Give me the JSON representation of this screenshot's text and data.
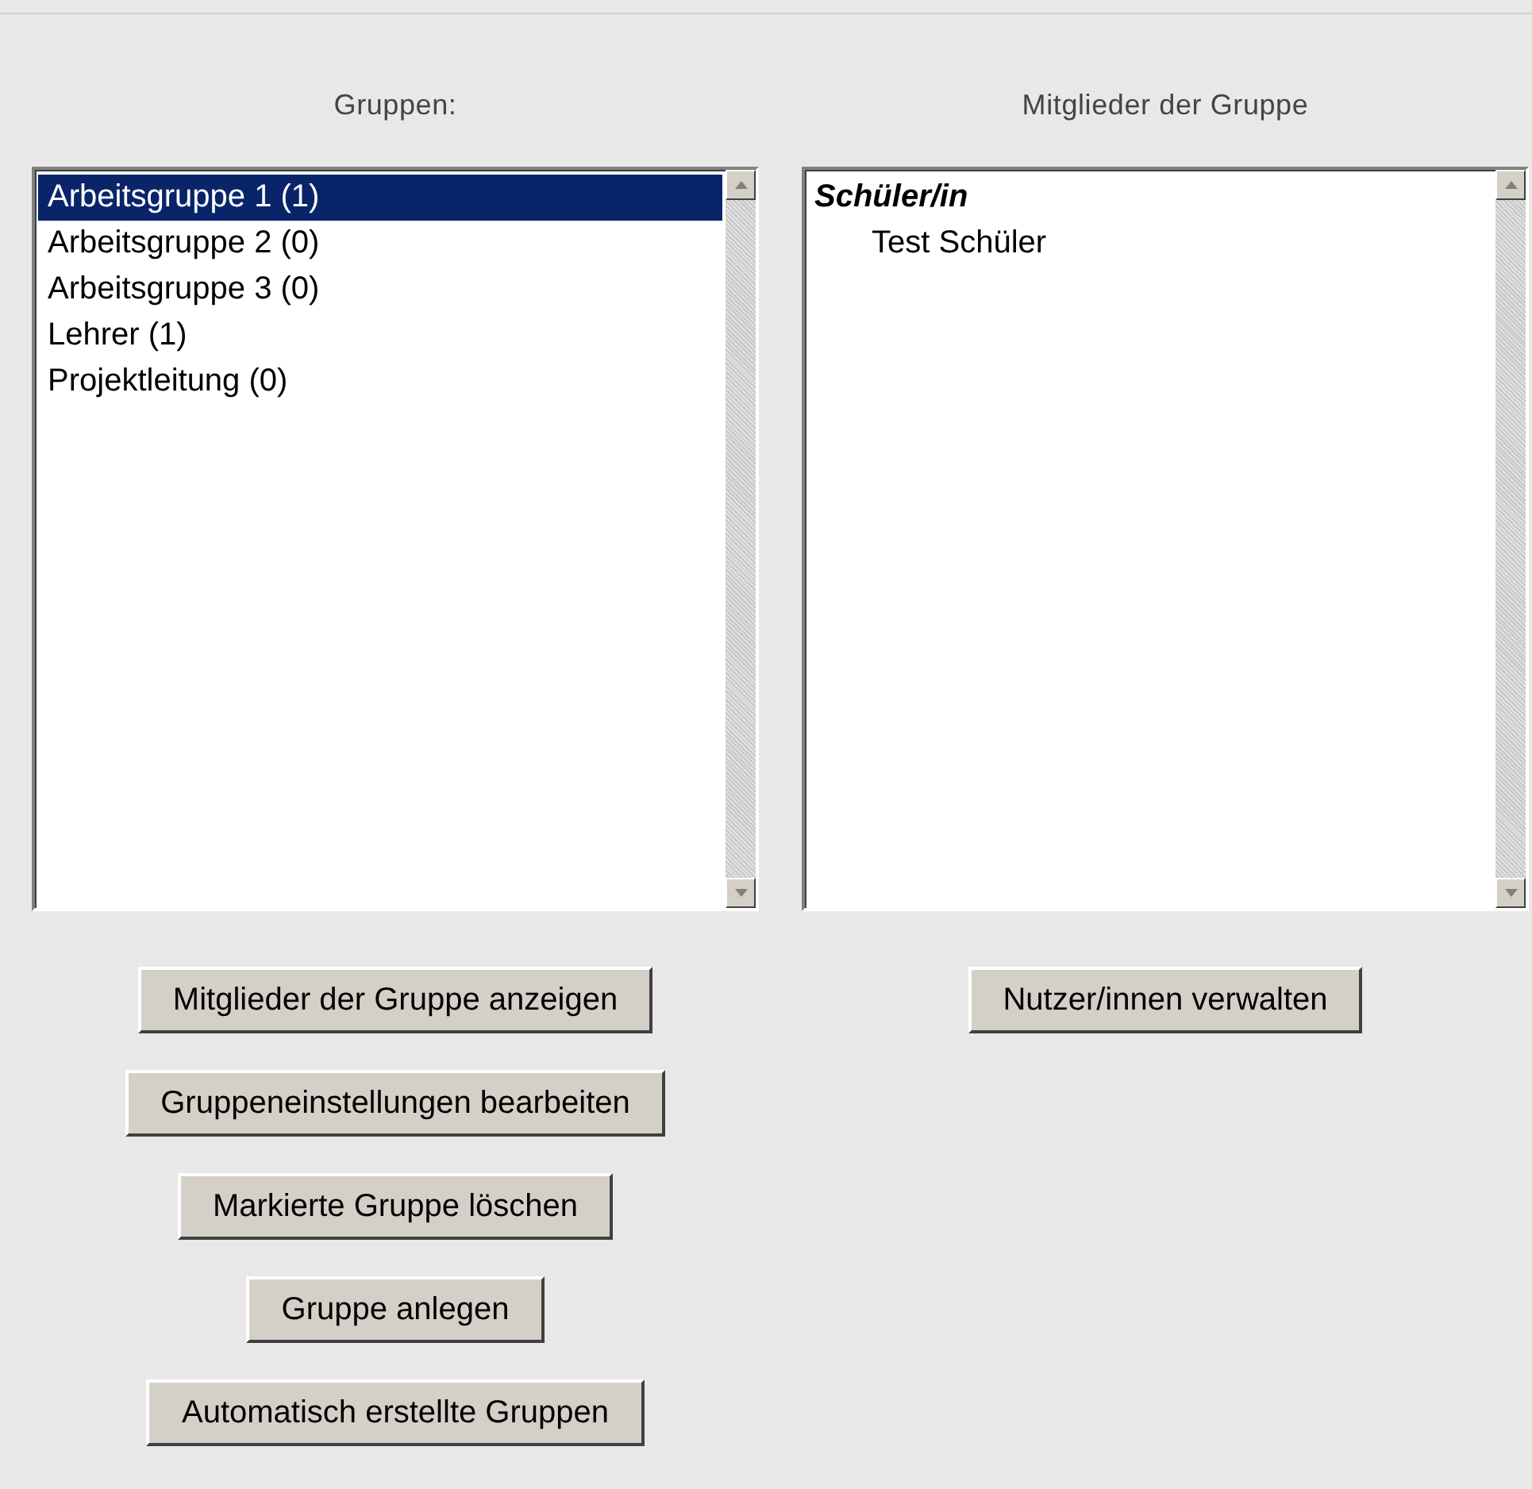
{
  "groups_panel": {
    "heading": "Gruppen:",
    "items": [
      {
        "label": "Arbeitsgruppe 1 (1)",
        "selected": true
      },
      {
        "label": "Arbeitsgruppe 2 (0)",
        "selected": false
      },
      {
        "label": "Arbeitsgruppe 3 (0)",
        "selected": false
      },
      {
        "label": "Lehrer (1)",
        "selected": false
      },
      {
        "label": "Projektleitung (0)",
        "selected": false
      }
    ]
  },
  "members_panel": {
    "heading": "Mitglieder der Gruppe",
    "groups": [
      {
        "label": "Schüler/in",
        "children": [
          {
            "label": "Test Schüler"
          }
        ]
      }
    ]
  },
  "left_buttons": [
    "Mitglieder der Gruppe anzeigen",
    "Gruppeneinstellungen bearbeiten",
    "Markierte Gruppe löschen",
    "Gruppe anlegen",
    "Automatisch erstellte Gruppen"
  ],
  "right_buttons": [
    "Nutzer/innen verwalten"
  ]
}
